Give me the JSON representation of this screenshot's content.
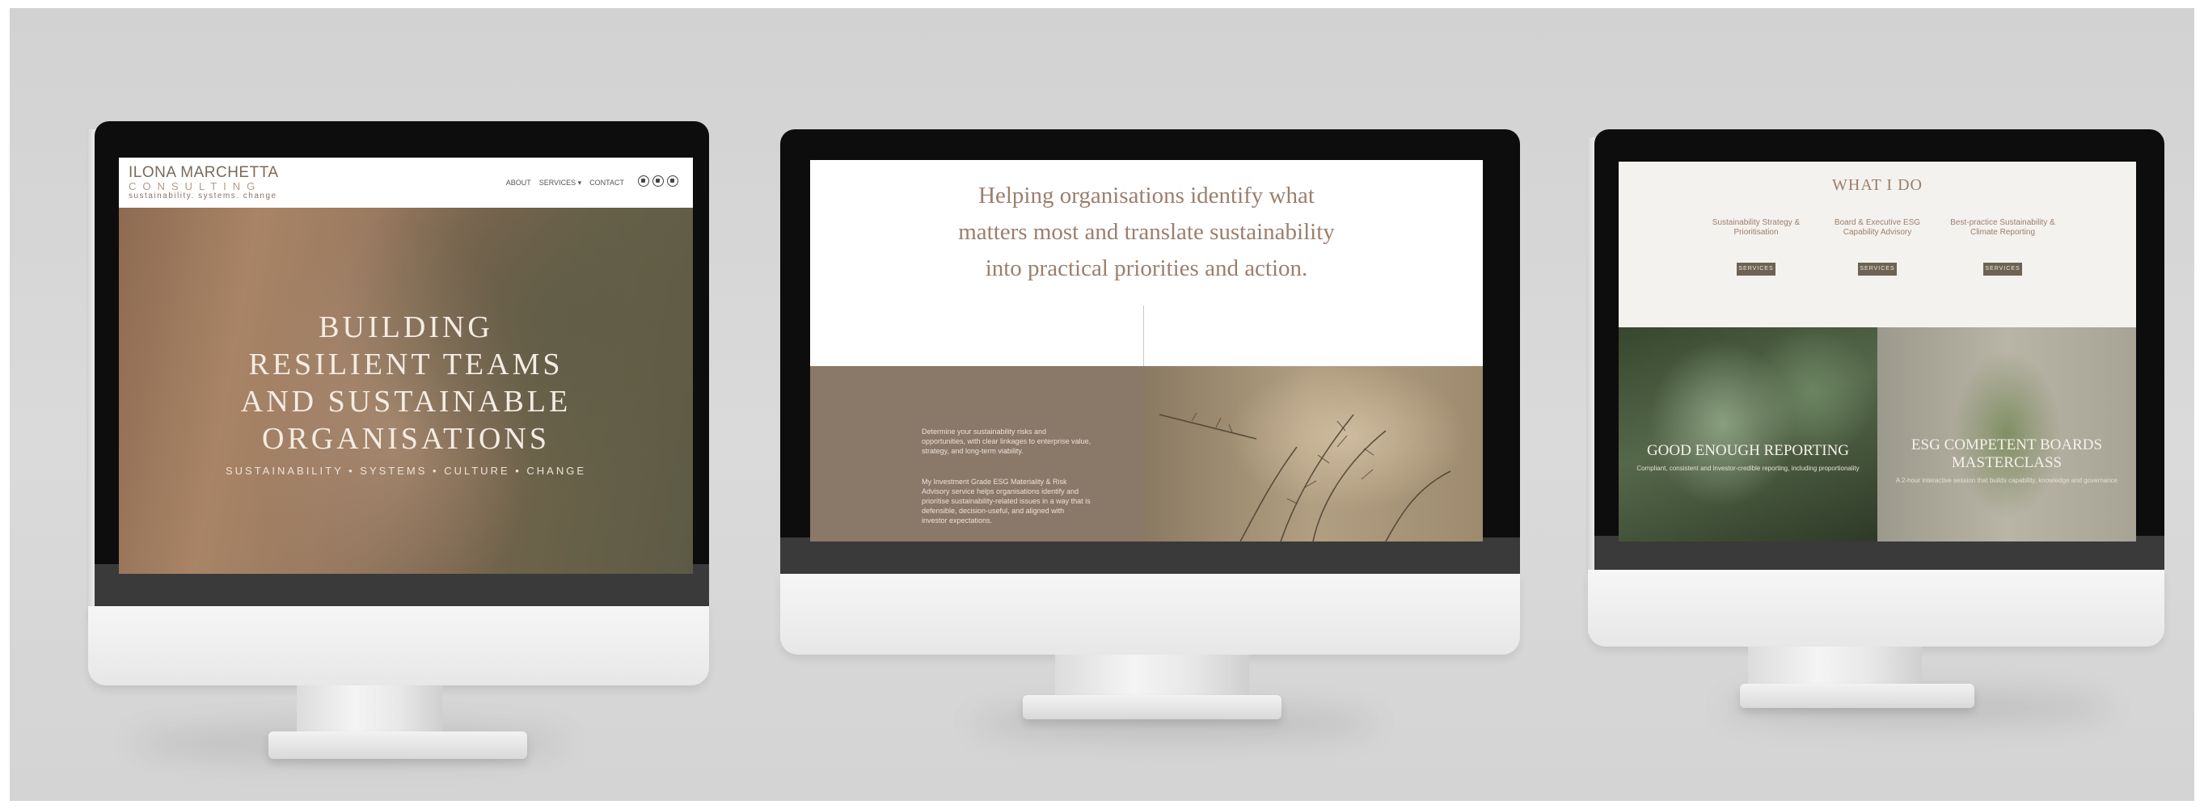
{
  "screen1": {
    "brand": "ILONA MARCHETTA",
    "brand_sub": "CONSULTING",
    "tagline": "sustainability. systems. change",
    "nav": [
      "ABOUT",
      "SERVICES ▾",
      "CONTACT"
    ],
    "social_icons": [
      "instagram-icon",
      "linkedin-icon",
      "email-icon"
    ],
    "hero_title": [
      "BUILDING",
      "RESILIENT TEAMS",
      "AND SUSTAINABLE",
      "ORGANISATIONS"
    ],
    "hero_tag": "SUSTAINABILITY • SYSTEMS • CULTURE • CHANGE"
  },
  "screen2": {
    "headline": [
      "Helping organisations identify what",
      "matters most and translate sustainability",
      "into practical priorities and action."
    ],
    "para1": "Determine your sustainability risks and opportunities, with clear linkages to enterprise value, strategy, and long-term viability.",
    "para2": "My Investment Grade ESG Materiality & Risk Advisory service helps organisations identify and prioritise sustainability-related issues in a way that is defensible, decision-useful, and aligned with investor expectations."
  },
  "screen3": {
    "heading": "WHAT I DO",
    "columns": [
      {
        "title": "Sustainability Strategy & Prioritisation",
        "button": "SERVICES"
      },
      {
        "title": "Board & Executive ESG Capability Advisory",
        "button": "SERVICES"
      },
      {
        "title": "Best-practice Sustainability & Climate Reporting",
        "button": "SERVICES"
      }
    ],
    "card1_title": "GOOD ENOUGH REPORTING",
    "card1_text": "Compliant, consistent and investor-credible reporting, including proportionality",
    "card2_title": [
      "ESG COMPETENT BOARDS",
      "MASTERCLASS"
    ],
    "card2_text": "A 2-hour interactive session that builds capability, knowledge and governance"
  }
}
